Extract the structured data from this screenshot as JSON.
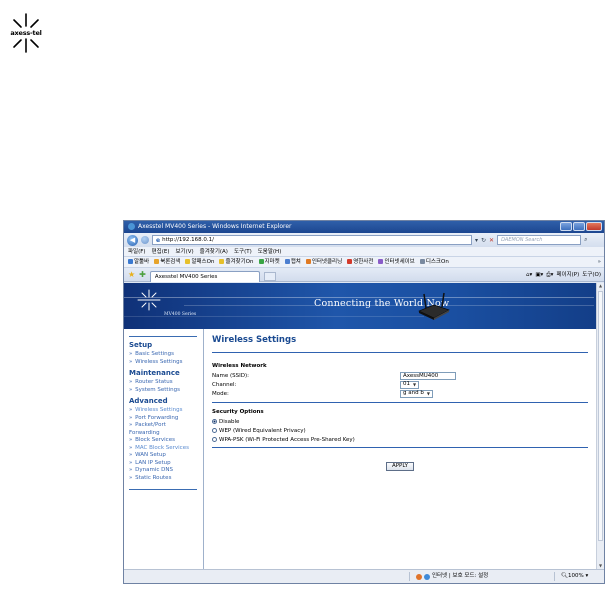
{
  "logo": {
    "text": "axess-tel"
  },
  "browser": {
    "window_title": "Axesstel MV400 Series - Windows Internet Explorer",
    "url": "http://192.168.0.1/",
    "search_placeholder": "DAEMON Search",
    "menu": [
      "파일(F)",
      "편집(E)",
      "보기(V)",
      "즐겨찾기(A)",
      "도구(T)",
      "도움말(H)"
    ],
    "links": [
      "알툴바",
      "북론검색",
      "알패스On",
      "즐겨찾기On",
      "지마켓",
      "캡쳐",
      "인터넷클리닝",
      "영한사전",
      "인터넷세이브",
      "디스크On"
    ],
    "tab_title": "Axesstel MV400 Series",
    "command_bar": [
      "페이지(P)",
      "도구(O)"
    ]
  },
  "banner": {
    "model": "MV400 Series",
    "tagline": "Connecting the World Now"
  },
  "sidebar": {
    "sections": [
      {
        "title": "Setup",
        "items": [
          "Basic Settings",
          "Wireless Settings"
        ]
      },
      {
        "title": "Maintenance",
        "items": [
          "Router Status",
          "System Settings"
        ]
      },
      {
        "title": "Advanced",
        "items": [
          "Wireless Settings",
          "Port Forwarding",
          "Packet/Port Forwarding",
          "Block Services",
          "MAC Block Services",
          "WAN Setup",
          "LAN IP Setup",
          "Dynamic DNS",
          "Static Routes"
        ]
      }
    ]
  },
  "content": {
    "title": "Wireless Settings",
    "network_section": "Wireless Network",
    "fields": {
      "ssid_label": "Name (SSID):",
      "ssid_value": "AxessMU400",
      "channel_label": "Channel:",
      "channel_value": "01",
      "mode_label": "Mode:",
      "mode_value": "g and b"
    },
    "security_section": "Security Options",
    "security_options": [
      "Disable",
      "WEP (Wired Equivalent Privacy)",
      "WPA-PSK (Wi-Fi Protected Access Pre-Shared Key)"
    ],
    "security_selected": 0,
    "apply_label": "APPLY"
  },
  "status": {
    "zone": "인터넷 | 보호 모드: 설정",
    "zoom": "100%"
  },
  "colors": {
    "accent": "#1a4a91",
    "link": "#3866b0",
    "banner": "#1f56aa"
  }
}
